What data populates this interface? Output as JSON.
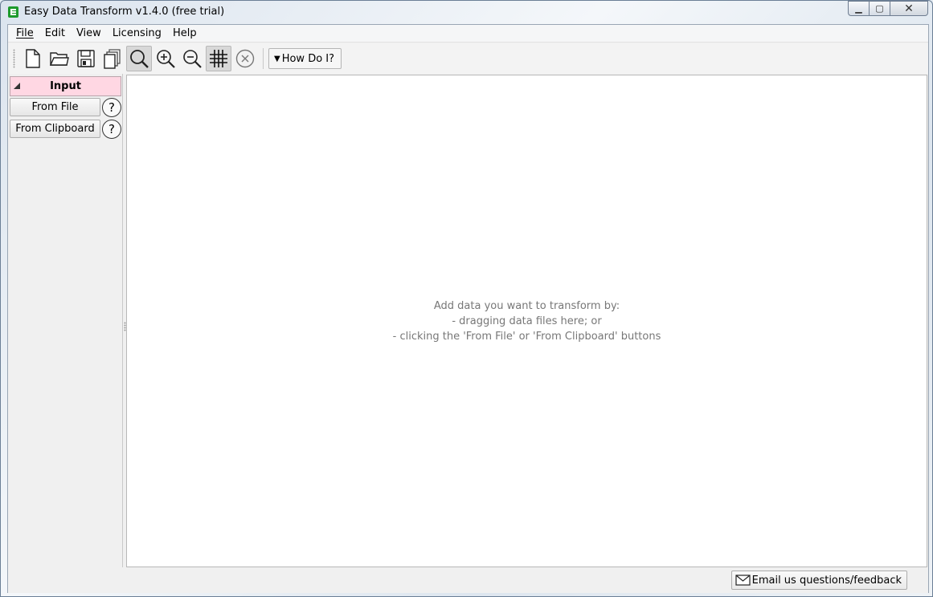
{
  "window": {
    "title": "Easy Data Transform v1.4.0 (free trial)",
    "min_glyph": "▁",
    "max_glyph": "▢",
    "close_glyph": "✕"
  },
  "menu": {
    "items": [
      {
        "label": "File"
      },
      {
        "label": "Edit"
      },
      {
        "label": "View"
      },
      {
        "label": "Licensing"
      },
      {
        "label": "Help"
      }
    ]
  },
  "toolbar": {
    "icons": [
      "new-file-icon",
      "open-folder-icon",
      "save-icon",
      "duplicate-icon",
      "zoom-fit-icon",
      "zoom-in-icon",
      "zoom-out-icon",
      "grid-icon",
      "clear-icon"
    ],
    "how_do_i_arrow": "▼",
    "how_do_i_label": "How Do I?"
  },
  "sidebar": {
    "section_label": "Input",
    "buttons": [
      {
        "label": "From File"
      },
      {
        "label": "From Clipboard"
      }
    ],
    "help_glyph": "?"
  },
  "canvas": {
    "hint_lines": [
      "Add data you want to transform by:",
      "- dragging data files here; or",
      "- clicking the 'From File' or 'From Clipboard' buttons"
    ]
  },
  "status": {
    "email_label": "Email us questions/feedback"
  },
  "colors": {
    "input_header_bg": "#ffd7e3",
    "app_icon": "#1d9a2c",
    "hint_text": "#777777"
  }
}
